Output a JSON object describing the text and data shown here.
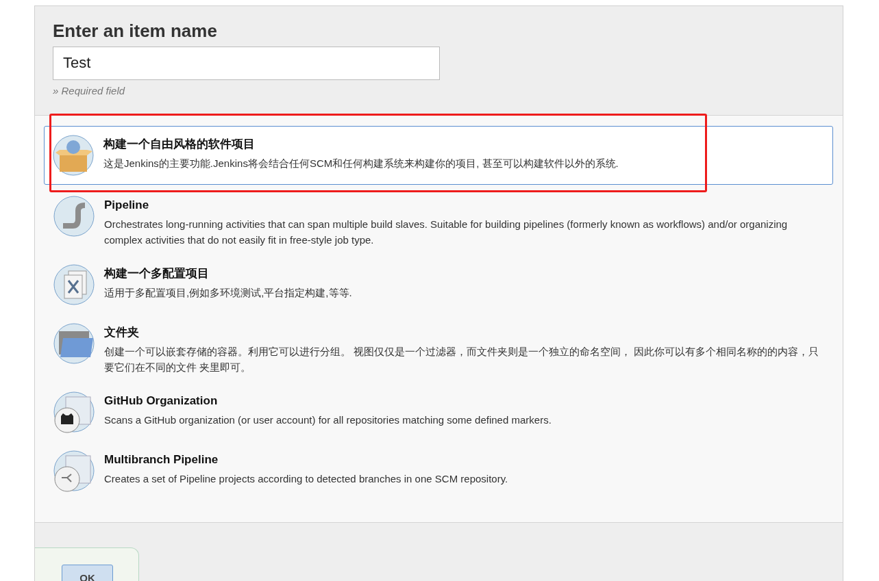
{
  "header": {
    "title": "Enter an item name",
    "name_field": {
      "value": "Test"
    },
    "hint": "» Required field"
  },
  "items": [
    {
      "kind": "freestyle",
      "title": "构建一个自由风格的软件项目",
      "description": "这是Jenkins的主要功能.Jenkins将会结合任何SCM和任何构建系统来构建你的项目, 甚至可以构建软件以外的系统.",
      "selected": true
    },
    {
      "kind": "pipeline",
      "title": "Pipeline",
      "description": "Orchestrates long-running activities that can span multiple build slaves. Suitable for building pipelines (formerly known as workflows) and/or organizing complex activities that do not easily fit in free-style job type.",
      "selected": false
    },
    {
      "kind": "matrix",
      "title": "构建一个多配置项目",
      "description": "适用于多配置项目,例如多环境测试,平台指定构建,等等.",
      "selected": false
    },
    {
      "kind": "folder",
      "title": "文件夹",
      "description": "创建一个可以嵌套存储的容器。利用它可以进行分组。 视图仅仅是一个过滤器，而文件夹则是一个独立的命名空间， 因此你可以有多个相同名称的的内容，只要它们在不同的文件 夹里即可。",
      "selected": false
    },
    {
      "kind": "github",
      "title": "GitHub Organization",
      "description": "Scans a GitHub organization (or user account) for all repositories matching some defined markers.",
      "selected": false
    },
    {
      "kind": "multibranch",
      "title": "Multibranch Pipeline",
      "description": "Creates a set of Pipeline projects according to detected branches in one SCM repository.",
      "selected": false
    }
  ],
  "footer": {
    "ok_button": "OK"
  }
}
